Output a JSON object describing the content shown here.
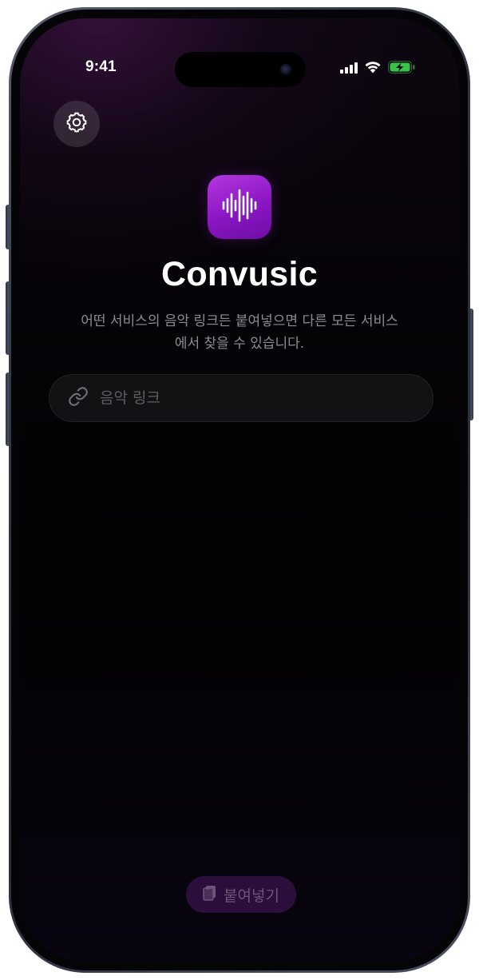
{
  "status_bar": {
    "time": "9:41"
  },
  "settings": {
    "icon": "gear-icon"
  },
  "app": {
    "name": "Convusic",
    "icon": "waveform-icon",
    "accent_color": "#9b22d6",
    "description": "어떤 서비스의 음악 링크든 붙여넣으면 다른 모든 서비스에서 찾을 수 있습니다."
  },
  "link_input": {
    "icon": "link-icon",
    "value": "",
    "placeholder": "음악 링크"
  },
  "paste_button": {
    "icon": "clipboard-icon",
    "label": "붙여넣기"
  }
}
